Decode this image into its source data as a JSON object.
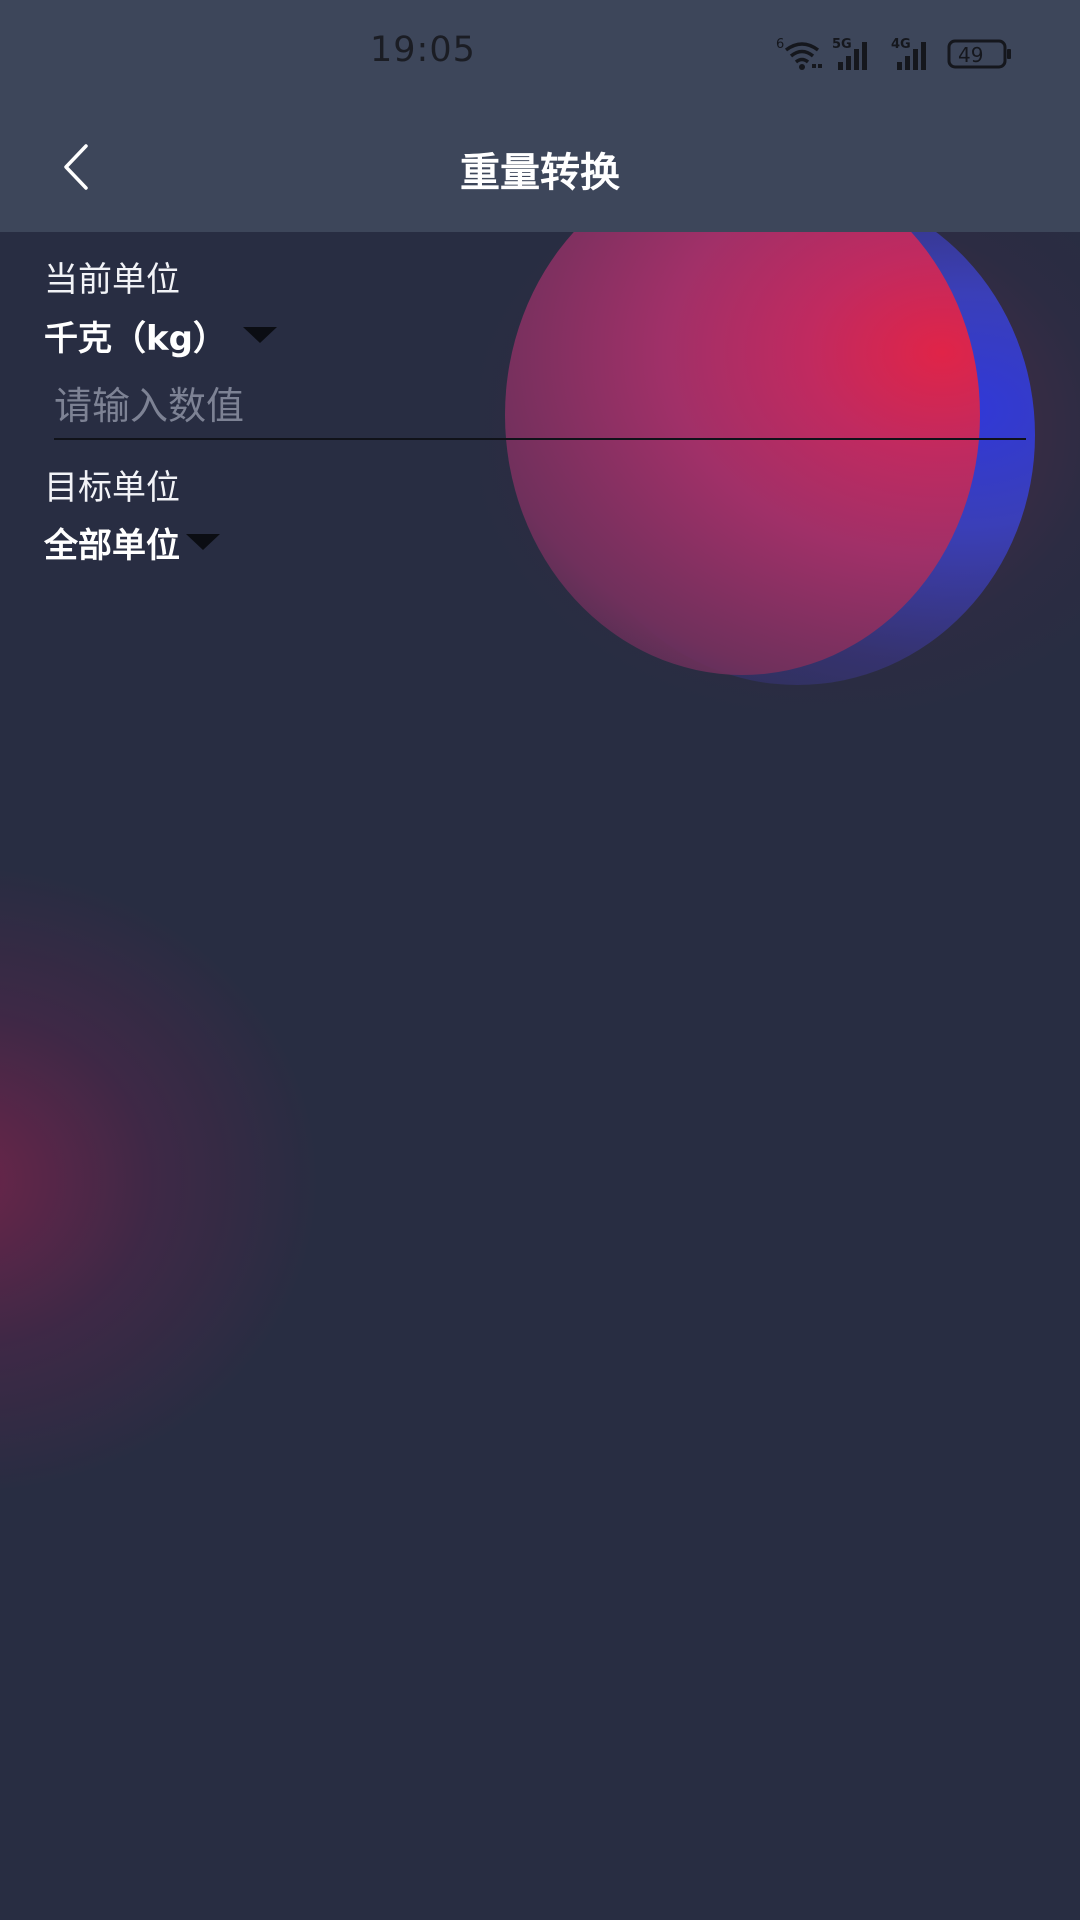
{
  "status_bar": {
    "time": "19:05",
    "wifi_badge": "6",
    "signal1_badge": "5G",
    "signal2_badge": "4G",
    "battery": "49",
    "icons": [
      "wifi-icon",
      "signal-5g-icon",
      "signal-4g-icon",
      "battery-icon"
    ]
  },
  "header": {
    "title": "重量转换",
    "back_icon": "chevron-left-icon"
  },
  "form": {
    "current_unit_label": "当前单位",
    "current_unit_value": "千克（kg）",
    "value_placeholder": "请输入数值",
    "value_input": "",
    "target_unit_label": "目标单位",
    "target_unit_value": "全部单位"
  },
  "colors": {
    "background": "#282d42",
    "header": "#3d465a",
    "orb_red": "#e02448",
    "orb_blue": "#3038d8"
  }
}
